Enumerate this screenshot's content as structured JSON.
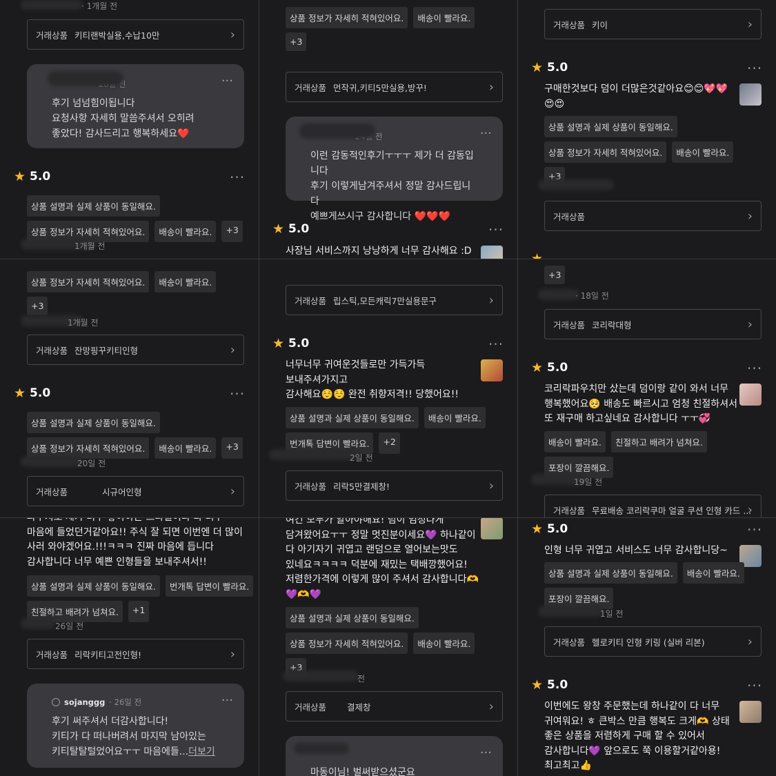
{
  "common": {
    "rating": "5.0",
    "product_label": "거래상품",
    "more_dots": "···"
  },
  "chips": {
    "same": "상품 설명과 실제 상품이 동일해요.",
    "detail": "상품 정보가 자세히 적혀있어요.",
    "fast": "배송이 빨라요.",
    "plus3": "+3",
    "plus2": "+2",
    "plus1": "+1",
    "reply_fast": "번개톡 답변이 빨라요.",
    "kind": "친절하고 배려가 넘쳐요.",
    "pack": "포장이 깔끔해요."
  },
  "c1": {
    "meta_top": "· 1개월 전",
    "prod": "키티랜박실용,수납10만",
    "reply_meta": "28일 전",
    "reply_lines": [
      "후기 넘넘힘이됩니다",
      "요청사항 자세히 말씀주셔서 오히려",
      "좋았다! 감사드리고 행복하세요❤️"
    ],
    "meta_bottom": "1개월 전"
  },
  "c2": {
    "prod": "먼작귀,키티5만실용,방꾸!",
    "reply_meta": "24일 전",
    "reply_lines": [
      "이런 감동적인후기ㅜㅜㅜ 제가 더 감동입니다",
      "후기 이렇게남겨주셔서 정말 감사드립니다",
      "예쁘게쓰시구 감사합니다 ❤️❤️❤️"
    ],
    "review": "사장님 서비스까지 낭낭하게 너무 감사해요 :D"
  },
  "c3": {
    "prod1": "키이",
    "review": [
      "구매한것보다 덤이 더많은것같아요😊😊💖💖",
      "😍😍"
    ],
    "prod2": ""
  },
  "c4": {
    "meta_mid": "1개월 전",
    "prod1": "잔망핑꾸키티인형",
    "meta_bottom": "20일 전",
    "prod2": "시규어인형"
  },
  "c5": {
    "prod1": "립스틱,모든캐릭7만실용문구",
    "review": [
      "너무너무 귀여운것들로만 가득가득",
      "보내주셔가지고",
      "감사해요☺️☺️ 완전 취향저격!! 당했어요!!"
    ],
    "meta_bottom": "2일 전",
    "prod2": "리락5만결제창!"
  },
  "c6": {
    "meta_top": "· 18일 전",
    "prod1": "코리락대형",
    "review": [
      "코리락파우치만 샀는데 덤이랑 같이 와서 너무",
      "행복했어요🥺 배송도 빠르시고 엄청 친절하셔서",
      "또 재구매 하고싶네요 감사합니다 ㅜㅜ💞"
    ],
    "meta_bottom": "19일 전",
    "prod2": "무료배송 코리락쿠마 얼굴 쿠션 인형 카드 ..."
  },
  "c7": {
    "review": [
      "파우치도 제가 너무 좋아하는 스타일이라 다 너무",
      "마음에 들었던거같아요!! 주식 잘 되면 이번엔 더 많이",
      "사러 와야겠어요.!!!ㅋㅋㅋ 진짜 마음에 듭니다",
      "감사합니다 너무 예쁜 인형들을 보내주셔서!!"
    ],
    "meta": "26일 전",
    "prod": "리락키티고전인형!",
    "reply_user": "sojanggg",
    "reply_meta": "· 26일 전",
    "reply_lines": [
      "후기 써주셔서 더감사합니다!",
      "키티가 다 떠나버려서 마지막 남아있는",
      "키티탈탈털었어요ㅜㅜ 마음에들..."
    ],
    "more": "더보기"
  },
  "c8": {
    "review": [
      "여긴 모두가 알아야해요! 덤이 엄청나게",
      "담겨왔어요ㅜㅜ 정말 멋진분이세요💜 하나같이",
      "다 아기자기 귀엽고 랜덤으로 열어보는맛도",
      "있네요ㅋㅋㅋㅋ 덕분에 재밌는 택배깡했어요!",
      "저렴한가격에 이렇게 많이 주셔서 감사합니다🫶",
      "💜🫶💜"
    ],
    "meta": "전",
    "prod": "결제창",
    "reply_line": "마동이님! 벌써받으셨군요"
  },
  "c9": {
    "review1": "인형 너무 귀엽고 서비스도 너무 감사합니당~",
    "meta": "1일 전",
    "prod": "헬로키티 인형 키링 (실버 리본)",
    "review2": [
      "이번에도 왕창 주문했는데 하나같이 다 너무",
      "귀여워요! ㅎ 큰박스 만큼 행복도 크게🫶 상태",
      "좋은 상품을 저렴하게 구매 할 수 있어서",
      "감사합니다💜 앞으로도 쭉 이용할거같아용!",
      "최고최고👍"
    ]
  },
  "colors": {
    "background": "#1b1b1d",
    "chip": "#2e2e31",
    "star": "#f7b928",
    "reply_bubble": "#3a3a3e"
  }
}
